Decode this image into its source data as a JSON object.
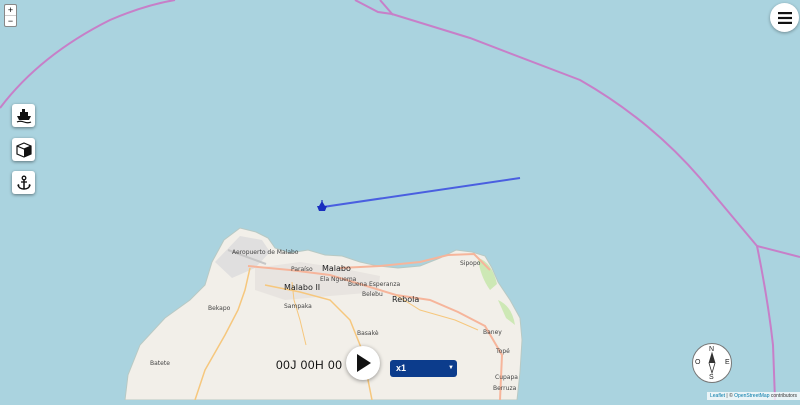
{
  "map": {
    "places": {
      "malabo": "Malabo",
      "malabo2": "Malabo II",
      "paraiso": "Paraíso",
      "ela_nguema": "Ela Nguema",
      "buena_esperanza": "Buena Esperanza",
      "sampaka": "Sampaka",
      "belebu": "Belebu",
      "rebola": "Rebola",
      "sipopo": "Sipopo",
      "baney": "Baney",
      "basake": "Basakè",
      "bekapo": "Bekapo",
      "batete": "Batete",
      "tope": "Topé",
      "cupapa": "Cupapa",
      "berruza": "Berruza",
      "airport": "Aeropuerto de Malabo"
    }
  },
  "zoom": {
    "in": "+",
    "out": "−"
  },
  "menu": {
    "icon": "hamburger-menu-icon"
  },
  "tools": [
    {
      "icon": "ship-icon"
    },
    {
      "icon": "cube-icon"
    },
    {
      "icon": "anchor-icon"
    }
  ],
  "playback": {
    "timer": "00J 00H 00",
    "speed": "x1",
    "speed_options": [
      "x1"
    ]
  },
  "compass": {
    "n": "N",
    "e": "E",
    "s": "S",
    "w": "O"
  },
  "attribution": {
    "leaflet": "Leaflet",
    "separator": " | © ",
    "osm": "OpenStreetMap",
    "suffix": " contributors"
  },
  "colors": {
    "sea": "#aad3df",
    "land": "#f2efe9",
    "border": "#c77fc8",
    "track": "#4a5fe0",
    "vessel": "#1a2fbf",
    "speed_bg": "#0c3c8c"
  }
}
